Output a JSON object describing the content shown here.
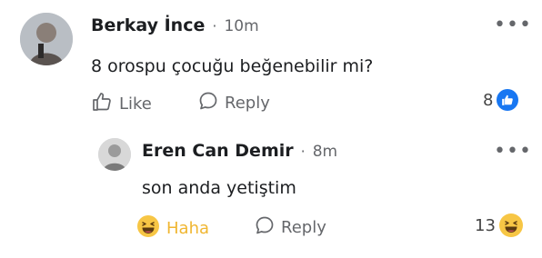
{
  "comment": {
    "author": "Berkay İnce",
    "separator": "·",
    "time": "10m",
    "text": "8 orospu çocuğu beğenebilir mi?",
    "like_label": "Like",
    "reply_label": "Reply",
    "reaction_count": "8",
    "reaction_icon": "like-reaction-icon",
    "more_icon": "more-options-icon"
  },
  "reply": {
    "author": "Eren Can Demir",
    "separator": "·",
    "time": "8m",
    "text": "son anda yetiştim",
    "reaction_label": "Haha",
    "reply_label": "Reply",
    "reaction_count": "13",
    "reaction_icon": "haha-reaction-icon",
    "more_icon": "more-options-icon"
  },
  "colors": {
    "like_blue": "#1877f2",
    "haha_yellow": "#f7c645",
    "secondary_text": "#65676b"
  }
}
